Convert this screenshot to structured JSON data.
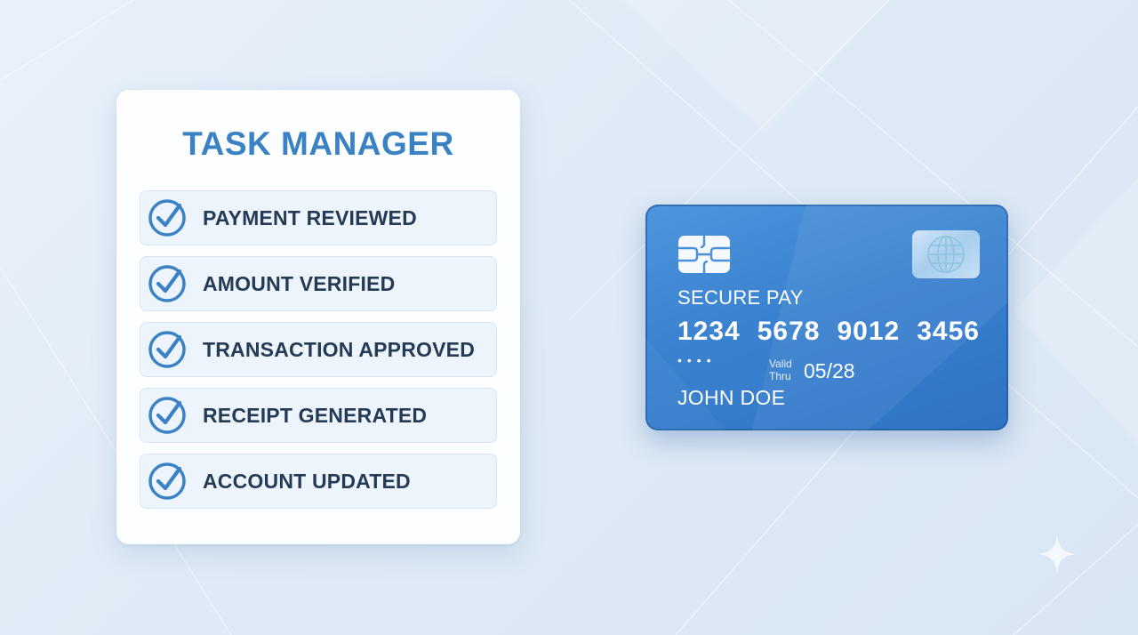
{
  "task_manager": {
    "title": "TASK MANAGER",
    "items": [
      {
        "label": "PAYMENT REVIEWED",
        "checked": true
      },
      {
        "label": "AMOUNT VERIFIED",
        "checked": true
      },
      {
        "label": "TRANSACTION APPROVED",
        "checked": true
      },
      {
        "label": "RECEIPT GENERATED",
        "checked": true
      },
      {
        "label": "ACCOUNT UPDATED",
        "checked": true
      }
    ]
  },
  "card": {
    "brand": "SECURE PAY",
    "number_groups": [
      "1234",
      "5678",
      "9012",
      "3456"
    ],
    "masked_dots": "••••",
    "valid_label_1": "Valid",
    "valid_label_2": "Thru",
    "expiry": "05/28",
    "holder": "JOHN DOE",
    "icons": [
      "chip-icon",
      "globe-icon"
    ]
  },
  "colors": {
    "accent": "#3b82c4",
    "card_blue": "#3a82d0",
    "text_dark": "#243a55",
    "background": "#e3edf8"
  }
}
